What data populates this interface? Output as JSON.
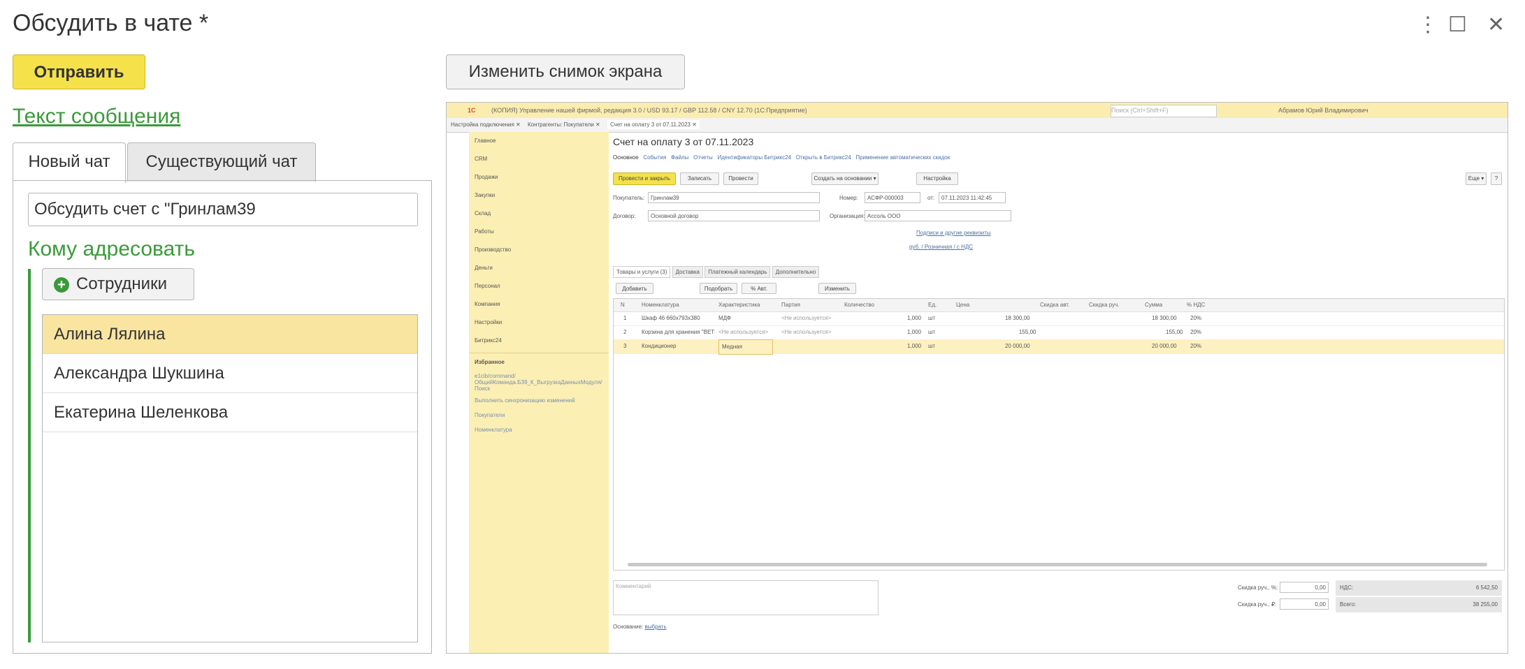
{
  "window": {
    "title": "Обсудить в чате *",
    "menu_icon": "⋮",
    "maximize_icon": "☐",
    "close_icon": "✕"
  },
  "toolbar": {
    "send_label": "Отправить",
    "change_screenshot_label": "Изменить снимок экрана"
  },
  "message_text_link": "Текст сообщения",
  "tabs": [
    {
      "label": "Новый чат"
    },
    {
      "label": "Существующий чат"
    }
  ],
  "chat_name_value": "Обсудить счет с \"Гринлам39",
  "address_heading": "Кому адресовать",
  "employees_button": {
    "label": "Сотрудники",
    "icon": "plus-circle-icon"
  },
  "recipients": [
    "Алина Лялина",
    "Александра Шукшина",
    "Екатерина Шеленкова"
  ],
  "screenshot": {
    "app_bar": "(КОПИЯ) Управление нашей фирмой, редакция 3.0 / USD 93.17 / GBP 112.58 / CNY 12.70  (1С:Предприятие)",
    "search_placeholder": "Поиск (Ctrl+Shift+F)",
    "user": "Абрамов Юрий Владимирович",
    "open_tabs": [
      "Настройка подключения ✕",
      "Контрагенты: Покупатели ✕",
      "Счет на оплату 3 от 07.11.2023 ✕"
    ],
    "sidebar": [
      "Главное",
      "CRM",
      "Продажи",
      "Закупки",
      "Склад",
      "Работы",
      "Производство",
      "Деньги",
      "Персонал",
      "Компания",
      "Настройки",
      "Битрикс24"
    ],
    "favorites_title": "Избранное",
    "favorites": [
      "e1cib/command/ОбщийКоманда.БЗ9_К_ВыгрузкаДанныхМодуля/Поиск",
      "Выполнить синхронизацию изменений",
      "Покупатели",
      "Номенклатура"
    ],
    "doc_title": "Счет на оплату 3 от 07.11.2023",
    "nav_links": [
      "Основное",
      "События",
      "Файлы",
      "Отчеты",
      "Идентификаторы Битрикс24",
      "Открыть в Битрикс24",
      "Применение автоматических скидок"
    ],
    "post_close": "Провести и закрыть",
    "write": "Записать",
    "post": "Провести",
    "create_based": "Создать на основании ▾",
    "settings": "Настройка",
    "more": "Еще ▾",
    "help": "?",
    "buyer_label": "Покупатель:",
    "buyer_value": "Гринлам39",
    "number_label": "Номер:",
    "number_value": "АСФР-000003",
    "date_from": "от:",
    "date_value": "07.11.2023 11:42:45",
    "contract_label": "Договор:",
    "contract_value": "Основной договор",
    "org_label": "Организация:",
    "org_value": "Ассоль ООО",
    "signatures_link": "Подписи и другие реквизиты",
    "price_link": "руб. / Розничная / с НДС",
    "subtabs": [
      "Товары и услуги (3)",
      "Доставка",
      "Платежный календарь",
      "Дополнительно"
    ],
    "add_btn": "Добавить",
    "pick_btn": "Подобрать",
    "pct_btn": "% Авт.",
    "change_btn": "Изменить",
    "columns": [
      "N",
      "Номенклатура",
      "Характеристика",
      "Партия",
      "Количество",
      "Ед.",
      "Цена",
      "Скидка авт.",
      "Скидка руч.",
      "Сумма",
      "% НДС"
    ],
    "rows": [
      {
        "n": "1",
        "name": "Шкаф 46 660x793x380",
        "char": "МДФ",
        "batch": "<Не используется>",
        "qty": "1,000",
        "unit": "шт",
        "price": "18 300,00",
        "sum": "18 300,00",
        "vat": "20%"
      },
      {
        "n": "2",
        "name": "Корзина для хранения \"ВЕТЕТ...",
        "char": "<Не используется>",
        "batch": "<Не используется>",
        "qty": "1,000",
        "unit": "шт",
        "price": "155,00",
        "sum": "155,00",
        "vat": "20%"
      },
      {
        "n": "3",
        "name": "Кондиционер",
        "char": "Медная",
        "batch": "",
        "qty": "1,000",
        "unit": "шт",
        "price": "20 000,00",
        "sum": "20 000,00",
        "vat": "20%"
      }
    ],
    "comment_placeholder": "Комментарий",
    "discount_pct_label": "Скидка руч., %:",
    "discount_pct_value": "0,00",
    "discount_sum_label": "Скидка руч., ₽:",
    "discount_sum_value": "0,00",
    "vat_label": "НДС:",
    "vat_value": "6 542,50",
    "total_label": "Всего:",
    "total_value": "38 255,00",
    "basis_label": "Основание:",
    "basis_link": "выбрать"
  }
}
